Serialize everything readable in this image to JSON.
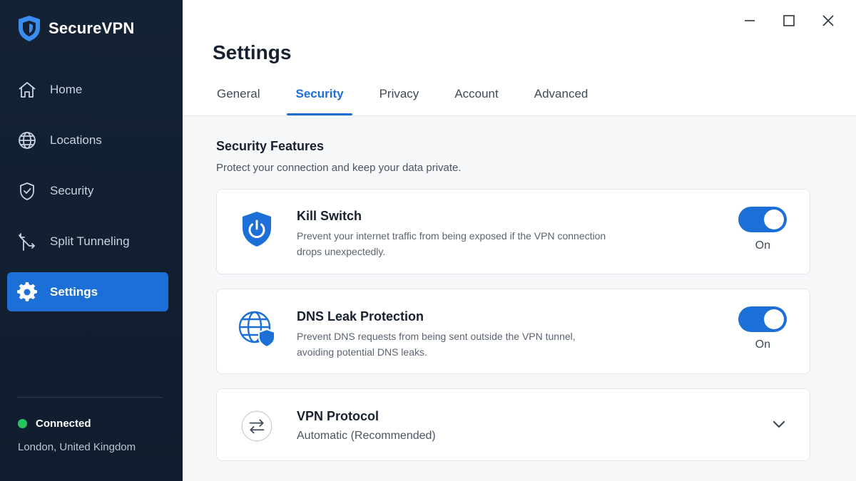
{
  "app": {
    "name": "SecureVPN",
    "brand_color": "#1d6fd8"
  },
  "sidebar": {
    "items": [
      {
        "label": "Home",
        "icon": "home-icon"
      },
      {
        "label": "Locations",
        "icon": "globe-icon"
      },
      {
        "label": "Security",
        "icon": "shield-check-icon"
      },
      {
        "label": "Split Tunneling",
        "icon": "split-arrow-icon"
      },
      {
        "label": "Settings",
        "icon": "gear-icon",
        "active": true
      }
    ],
    "status": {
      "label": "Connected",
      "color": "#22c55e"
    },
    "location": "London, United Kingdom"
  },
  "window": {
    "controls": [
      "minimize-icon",
      "maximize-icon",
      "close-icon"
    ]
  },
  "main": {
    "title": "Settings",
    "tabs": [
      {
        "label": "General"
      },
      {
        "label": "Security",
        "active": true
      },
      {
        "label": "Privacy"
      },
      {
        "label": "Account"
      },
      {
        "label": "Advanced"
      }
    ],
    "section": {
      "title": "Security Features",
      "subtitle": "Protect your connection and keep your data private."
    },
    "cards": {
      "kill_switch": {
        "title": "Kill Switch",
        "description": "Prevent your internet traffic from being exposed if the VPN connection drops unexpectedly.",
        "state": "On",
        "enabled": true,
        "icon": "shield-power-icon"
      },
      "dns_leak": {
        "title": "DNS Leak Protection",
        "description": "Prevent DNS requests from being sent outside the VPN tunnel, avoiding potential DNS leaks.",
        "state": "On",
        "enabled": true,
        "icon": "globe-shield-icon"
      },
      "protocol": {
        "title": "VPN Protocol",
        "value": "Automatic (Recommended)",
        "icon": "swap-arrows-icon"
      }
    }
  }
}
